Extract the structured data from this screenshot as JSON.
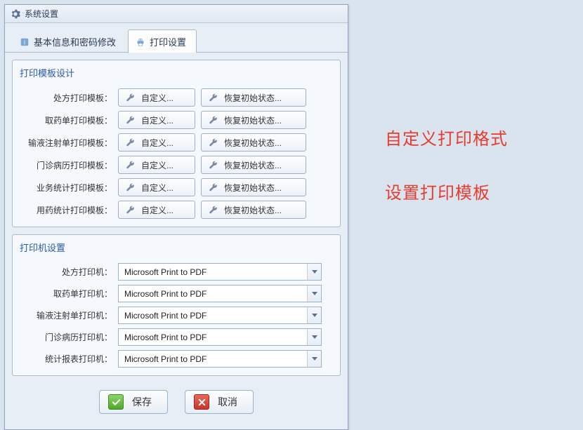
{
  "window": {
    "title": "系统设置"
  },
  "tabs": {
    "basic": "基本信息和密码修改",
    "print": "打印设置"
  },
  "group_template": {
    "title": "打印模板设计",
    "rows": [
      {
        "label": "处方打印模板：",
        "custom": "自定义...",
        "restore": "恢复初始状态..."
      },
      {
        "label": "取药单打印模板：",
        "custom": "自定义...",
        "restore": "恢复初始状态..."
      },
      {
        "label": "输液注射单打印模板：",
        "custom": "自定义...",
        "restore": "恢复初始状态..."
      },
      {
        "label": "门诊病历打印模板：",
        "custom": "自定义...",
        "restore": "恢复初始状态..."
      },
      {
        "label": "业务统计打印模板：",
        "custom": "自定义...",
        "restore": "恢复初始状态..."
      },
      {
        "label": "用药统计打印模板：",
        "custom": "自定义...",
        "restore": "恢复初始状态..."
      }
    ]
  },
  "group_printer": {
    "title": "打印机设置",
    "rows": [
      {
        "label": "处方打印机：",
        "value": "Microsoft Print to PDF"
      },
      {
        "label": "取药单打印机：",
        "value": "Microsoft Print to PDF"
      },
      {
        "label": "输液注射单打印机：",
        "value": "Microsoft Print to PDF"
      },
      {
        "label": "门诊病历打印机：",
        "value": "Microsoft Print to PDF"
      },
      {
        "label": "统计报表打印机：",
        "value": "Microsoft Print to PDF"
      }
    ]
  },
  "footer": {
    "save": "保存",
    "cancel": "取消"
  },
  "annotations": {
    "a": "自定义打印格式",
    "b": "设置打印模板"
  }
}
